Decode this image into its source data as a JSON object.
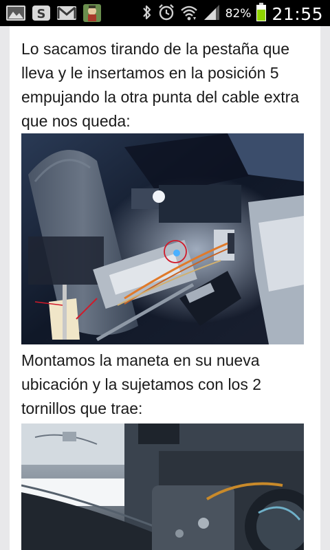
{
  "status_bar": {
    "battery_percent": "82%",
    "time": "21:55",
    "battery_level": 0.82,
    "icons": [
      "gallery-notification-icon",
      "s-app-notification-icon",
      "gmail-notification-icon",
      "app-notification-icon",
      "bluetooth-icon",
      "alarm-icon",
      "wifi-icon",
      "signal-icon",
      "battery-icon"
    ]
  },
  "article": {
    "paragraph_1": "Lo sacamos tirando de la pestaña que lleva y le insertamos en la posición 5 empujando la otra punta del cable extra que nos queda:",
    "paragraph_2": "Montamos la maneta en su nueva ubicación y la sujetamos con los 2 tornillos que trae:"
  },
  "colors": {
    "status_bar_bg": "#000000",
    "page_bg": "#ffffff",
    "gutter": "#e8e8ea",
    "battery_green": "#8fd400"
  }
}
